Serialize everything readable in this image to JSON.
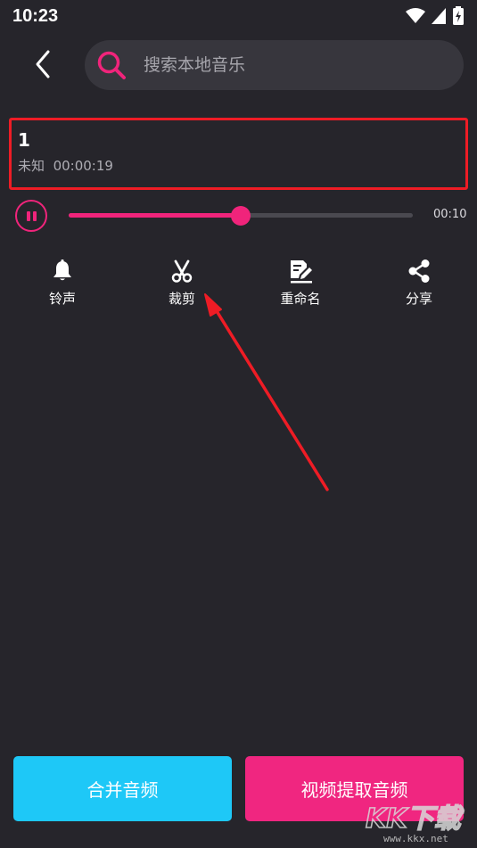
{
  "status_bar": {
    "time": "10:23"
  },
  "search": {
    "placeholder": "搜索本地音乐",
    "value": ""
  },
  "song": {
    "title": "1",
    "artist": "未知",
    "duration": "00:00:19"
  },
  "player": {
    "current_time": "00:10",
    "progress": 0.5,
    "state": "playing"
  },
  "actions": [
    {
      "label": "铃声",
      "icon": "bell-icon"
    },
    {
      "label": "裁剪",
      "icon": "scissors-icon"
    },
    {
      "label": "重命名",
      "icon": "rename-icon"
    },
    {
      "label": "分享",
      "icon": "share-icon"
    }
  ],
  "buttons": {
    "merge_label": "合并音频",
    "extract_label": "视频提取音频"
  },
  "watermark": {
    "site": "www.kkx.net"
  },
  "colors": {
    "background": "#26252b",
    "accent": "#f0247b",
    "highlight_border": "#ee1c25",
    "merge_button": "#1ec8f7",
    "extract_button": "#f02680"
  }
}
